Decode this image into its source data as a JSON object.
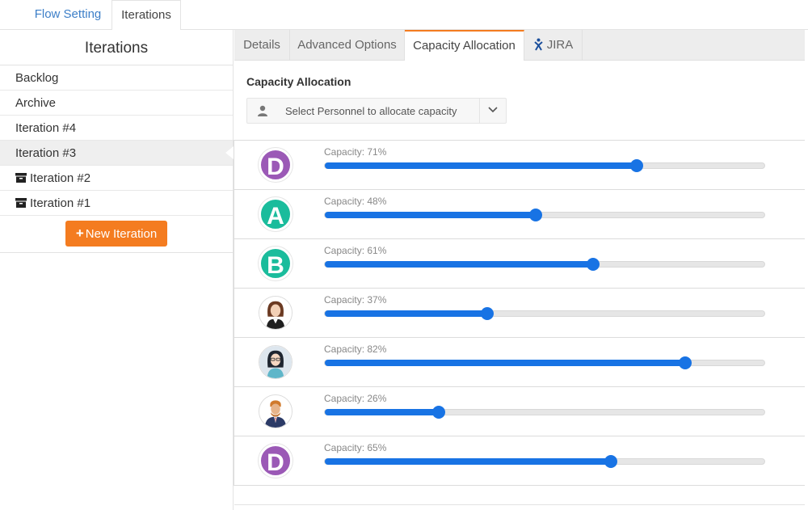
{
  "top_tabs": {
    "flow_setting": "Flow Setting",
    "iterations": "Iterations"
  },
  "sidebar": {
    "title": "Iterations",
    "items": [
      {
        "label": "Backlog",
        "archived": false,
        "active": false
      },
      {
        "label": "Archive",
        "archived": false,
        "active": false
      },
      {
        "label": "Iteration #4",
        "archived": false,
        "active": false
      },
      {
        "label": "Iteration #3",
        "archived": false,
        "active": true
      },
      {
        "label": "Iteration #2",
        "archived": true,
        "active": false
      },
      {
        "label": "Iteration #1",
        "archived": true,
        "active": false
      }
    ],
    "new_button": "New Iteration",
    "new_button_icon": "plus-icon"
  },
  "panel_tabs": {
    "details": "Details",
    "advanced": "Advanced Options",
    "capacity": "Capacity Allocation",
    "jira": "JIRA"
  },
  "capacity": {
    "heading": "Capacity Allocation",
    "selector_placeholder": "Select Personnel to allocate capacity",
    "people": [
      {
        "avatar": "D",
        "avatar_color": "#9b59b6",
        "label": "Capacity: 71%",
        "value": 71
      },
      {
        "avatar": "A",
        "avatar_color": "#1abc9c",
        "label": "Capacity: 48%",
        "value": 48
      },
      {
        "avatar": "B",
        "avatar_color": "#1abc9c",
        "label": "Capacity: 61%",
        "value": 61
      },
      {
        "avatar": "photo-woman-1",
        "avatar_color": "",
        "label": "Capacity: 37%",
        "value": 37
      },
      {
        "avatar": "photo-woman-2",
        "avatar_color": "",
        "label": "Capacity: 82%",
        "value": 82
      },
      {
        "avatar": "photo-man-1",
        "avatar_color": "",
        "label": "Capacity: 26%",
        "value": 26
      },
      {
        "avatar": "D",
        "avatar_color": "#9b59b6",
        "label": "Capacity: 65%",
        "value": 65
      }
    ]
  },
  "colors": {
    "accent": "#f47c20",
    "slider": "#1873e4",
    "link": "#3d7fc8"
  }
}
